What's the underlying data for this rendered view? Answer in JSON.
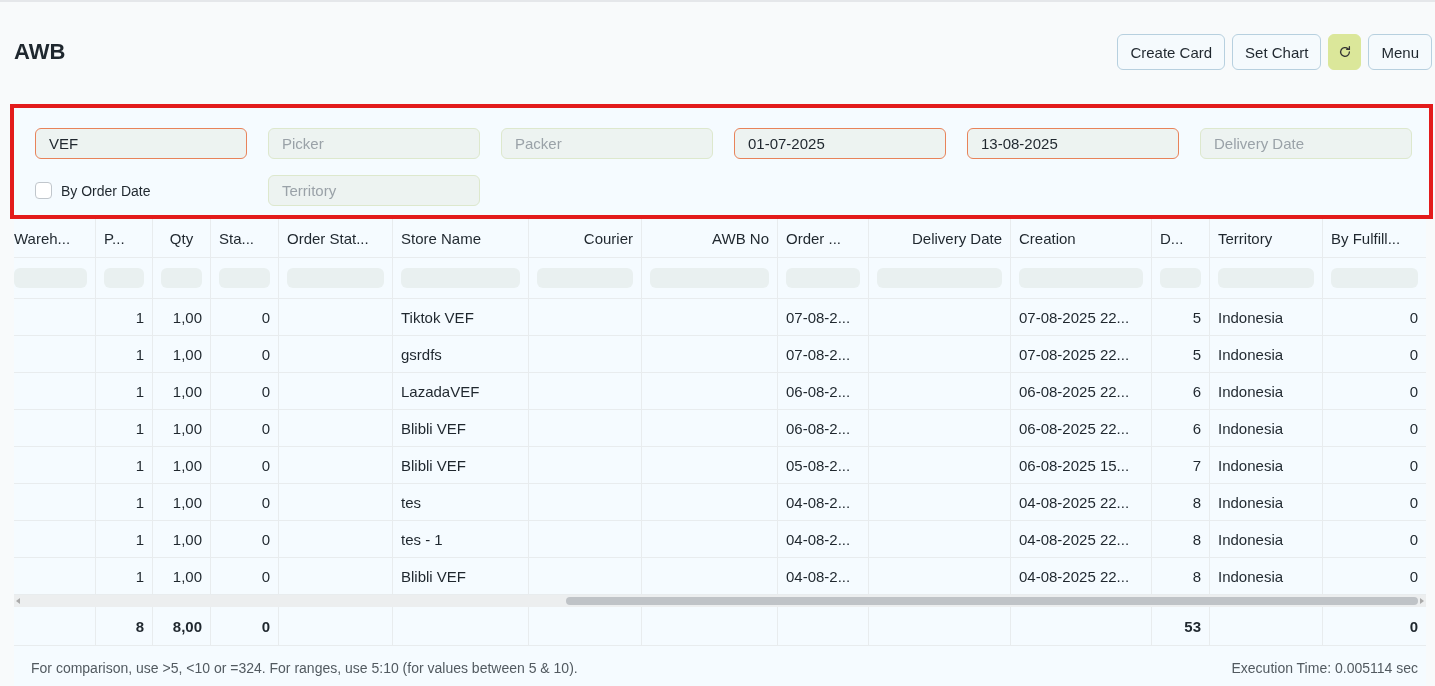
{
  "page": {
    "title": "AWB"
  },
  "actions": [
    {
      "kind": "text",
      "label": "Create Card"
    },
    {
      "kind": "text",
      "label": "Set Chart"
    },
    {
      "kind": "refresh"
    },
    {
      "kind": "text",
      "label": "Menu"
    }
  ],
  "filters": [
    {
      "kind": "field",
      "value": "VEF"
    },
    {
      "kind": "field",
      "placeholder": "Picker"
    },
    {
      "kind": "field",
      "placeholder": "Packer"
    },
    {
      "kind": "field",
      "value": "01-07-2025"
    },
    {
      "kind": "field",
      "value": "13-08-2025"
    },
    {
      "kind": "field",
      "placeholder": "Delivery Date"
    },
    {
      "kind": "checkbox",
      "label": "By Order Date",
      "checked": false
    },
    {
      "kind": "field",
      "placeholder": "Territory"
    }
  ],
  "table": {
    "columns": [
      {
        "label": "Wareh..."
      },
      {
        "label": "P...",
        "total": "8"
      },
      {
        "label": "Qty",
        "total": "8,00"
      },
      {
        "label": "Sta...",
        "total": "0"
      },
      {
        "label": "Order Stat..."
      },
      {
        "label": "Store Name"
      },
      {
        "label": "Courier"
      },
      {
        "label": "AWB No"
      },
      {
        "label": "Order ..."
      },
      {
        "label": "Delivery Date"
      },
      {
        "label": "Creation"
      },
      {
        "label": "D...",
        "total": "53"
      },
      {
        "label": "Territory"
      },
      {
        "label": "By Fulfill...",
        "total": "0"
      }
    ],
    "rows": [
      {
        "column_2": "1",
        "qty": "1,00",
        "column_4": "0",
        "store_name": "Tiktok VEF",
        "column_9": "07-08-2...",
        "creation": "07-08-2025 22...",
        "column_12": "5",
        "territory": "Indonesia",
        "column_14": "0"
      },
      {
        "column_2": "1",
        "qty": "1,00",
        "column_4": "0",
        "store_name": "gsrdfs",
        "column_9": "07-08-2...",
        "creation": "07-08-2025 22...",
        "column_12": "5",
        "territory": "Indonesia",
        "column_14": "0"
      },
      {
        "column_2": "1",
        "qty": "1,00",
        "column_4": "0",
        "store_name": "LazadaVEF",
        "column_9": "06-08-2...",
        "creation": "06-08-2025 22...",
        "column_12": "6",
        "territory": "Indonesia",
        "column_14": "0"
      },
      {
        "column_2": "1",
        "qty": "1,00",
        "column_4": "0",
        "store_name": "Blibli VEF",
        "column_9": "06-08-2...",
        "creation": "06-08-2025 22...",
        "column_12": "6",
        "territory": "Indonesia",
        "column_14": "0"
      },
      {
        "column_2": "1",
        "qty": "1,00",
        "column_4": "0",
        "store_name": "Blibli VEF",
        "column_9": "05-08-2...",
        "creation": "06-08-2025 15...",
        "column_12": "7",
        "territory": "Indonesia",
        "column_14": "0"
      },
      {
        "column_2": "1",
        "qty": "1,00",
        "column_4": "0",
        "store_name": "tes",
        "column_9": "04-08-2...",
        "creation": "04-08-2025 22...",
        "column_12": "8",
        "territory": "Indonesia",
        "column_14": "0"
      },
      {
        "column_2": "1",
        "qty": "1,00",
        "column_4": "0",
        "store_name": "tes - 1",
        "column_9": "04-08-2...",
        "creation": "04-08-2025 22...",
        "column_12": "8",
        "territory": "Indonesia",
        "column_14": "0"
      },
      {
        "column_2": "1",
        "qty": "1,00",
        "column_4": "0",
        "store_name": "Blibli VEF",
        "column_9": "04-08-2...",
        "creation": "04-08-2025 22...",
        "column_12": "8",
        "territory": "Indonesia",
        "column_14": "0"
      }
    ]
  },
  "footer": {
    "hint": "For comparison, use >5, <10 or =324. For ranges, use 5:10 (for values between 5 & 10).",
    "execution_time": "Execution Time: 0.005114 sec"
  }
}
